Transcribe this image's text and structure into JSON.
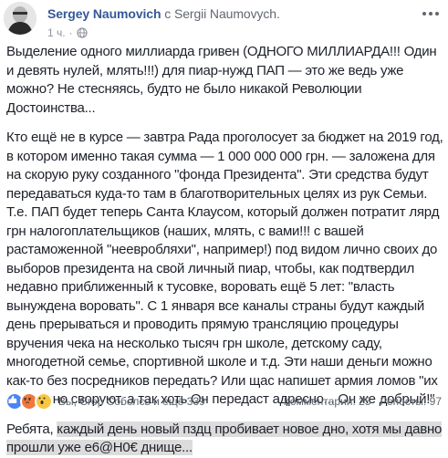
{
  "post": {
    "author": "Sergey Naumovich",
    "with_word": "с",
    "target": "Sergii Naumovych.",
    "time": "1 ч.",
    "audience_icon": "globe-icon",
    "more_icon": "more-options-icon"
  },
  "content": {
    "paragraphs": [
      "Выделение одного миллиарда гривен (ОДНОГО МИЛЛИАРДА!!! Один и девять нулей, млять!!!) для пиар-нужд ПАП — это же ведь уже можно? Не стесняясь, будто не было никакой Революции Достоинства...",
      "Кто ещё не в курсе — завтра Рада проголосует за бюджет на 2019 год, в котором именно такая сумма — 1 000 000 000 грн. — заложена для на скорую руку созданного \"фонда Президента\". Эти средства будут передаваться куда-то там в благотворительных целях из рук Семьи. Т.е. ПАП будет теперь Санта Клаусом, который должен потратит ляpд грн налогоплательщиков (наших, млять, с вами!!! с вашей растаможенной \"неевробляхи\", например!) под видом лично своих до выборов президента на свой личный пиар, чтобы, как подтвердил недавно приближенный к тусовке, воровать ещё 5 лет: \"власть вынуждена воровать\". С 1 января все каналы страны будут каждый день прерываться и проводить прямую трансляцию процедуры вручения чека на несколько тысяч грн школе, детскому саду, многодетной семье, спортивной школе и т.д. Эти наши деньги можно как-то без посредников передать? Или щас напишет армия ломов \"их все равно своруют, а так хоть Он передаст адресно... Он же добрый!\""
    ],
    "last_plain": "Ребята, ",
    "last_highlight": "каждый день новый пздц пробивает новое дно, хотя мы давно прошли уже е6@Н0€ днище...",
    "highlight_color": "#dcdcdc"
  },
  "footer": {
    "reactions": [
      "like-icon",
      "angry-icon",
      "wow-icon"
    ],
    "reactions_text": "Вы, Єгор Соболєв и ещё 339",
    "comments": "Комментарии: 25",
    "shares": "Репосты: 97"
  },
  "colors": {
    "link": "#365899",
    "text": "#1d2129",
    "muted": "#90949c"
  }
}
